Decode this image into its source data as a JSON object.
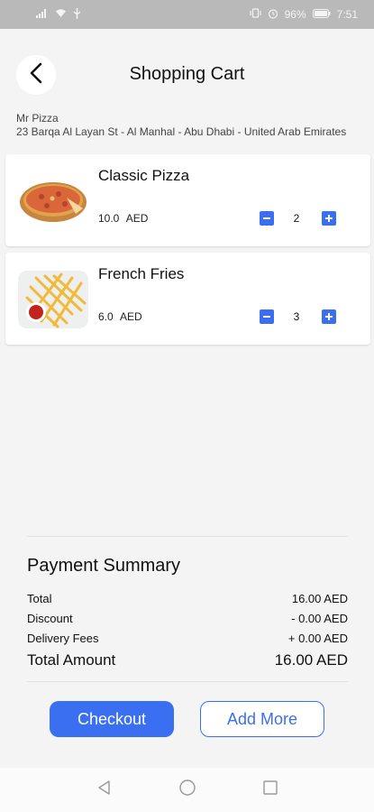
{
  "status_bar": {
    "left_icons": [
      "signal-icon",
      "wifi-icon",
      "usb-icon"
    ],
    "right_icons": [
      "vibrate-icon",
      "alarm-icon"
    ],
    "battery": "96%",
    "time": "7:51"
  },
  "header": {
    "back_icon": "back-arrow-icon",
    "title": "Shopping Cart"
  },
  "restaurant": {
    "name": "Mr Pizza",
    "address": "23 Barqa Al Layan St - Al Manhal - Abu Dhabi - United Arab Emirates"
  },
  "cart": {
    "items": [
      {
        "name": "Classic Pizza",
        "price": "10.0",
        "currency": "AED",
        "quantity": "2",
        "image_icon": "pizza-image"
      },
      {
        "name": "French Fries",
        "price": "6.0",
        "currency": "AED",
        "quantity": "3",
        "image_icon": "fries-image"
      }
    ]
  },
  "summary": {
    "title": "Payment Summary",
    "rows": [
      {
        "label": "Total",
        "value": "16.00  AED"
      },
      {
        "label": "Discount",
        "value": "- 0.00 AED"
      },
      {
        "label": "Delivery Fees",
        "value": "+ 0.00 AED"
      }
    ],
    "total_label": "Total Amount",
    "total_value": "16.00  AED"
  },
  "actions": {
    "checkout_label": "Checkout",
    "add_more_label": "Add More"
  },
  "colors": {
    "accent": "#3a6ff2",
    "background": "#f4f4f4",
    "status_bar": "#b9b9b9"
  },
  "nav": {
    "icons": [
      "nav-back-icon",
      "nav-home-icon",
      "nav-recents-icon"
    ]
  }
}
